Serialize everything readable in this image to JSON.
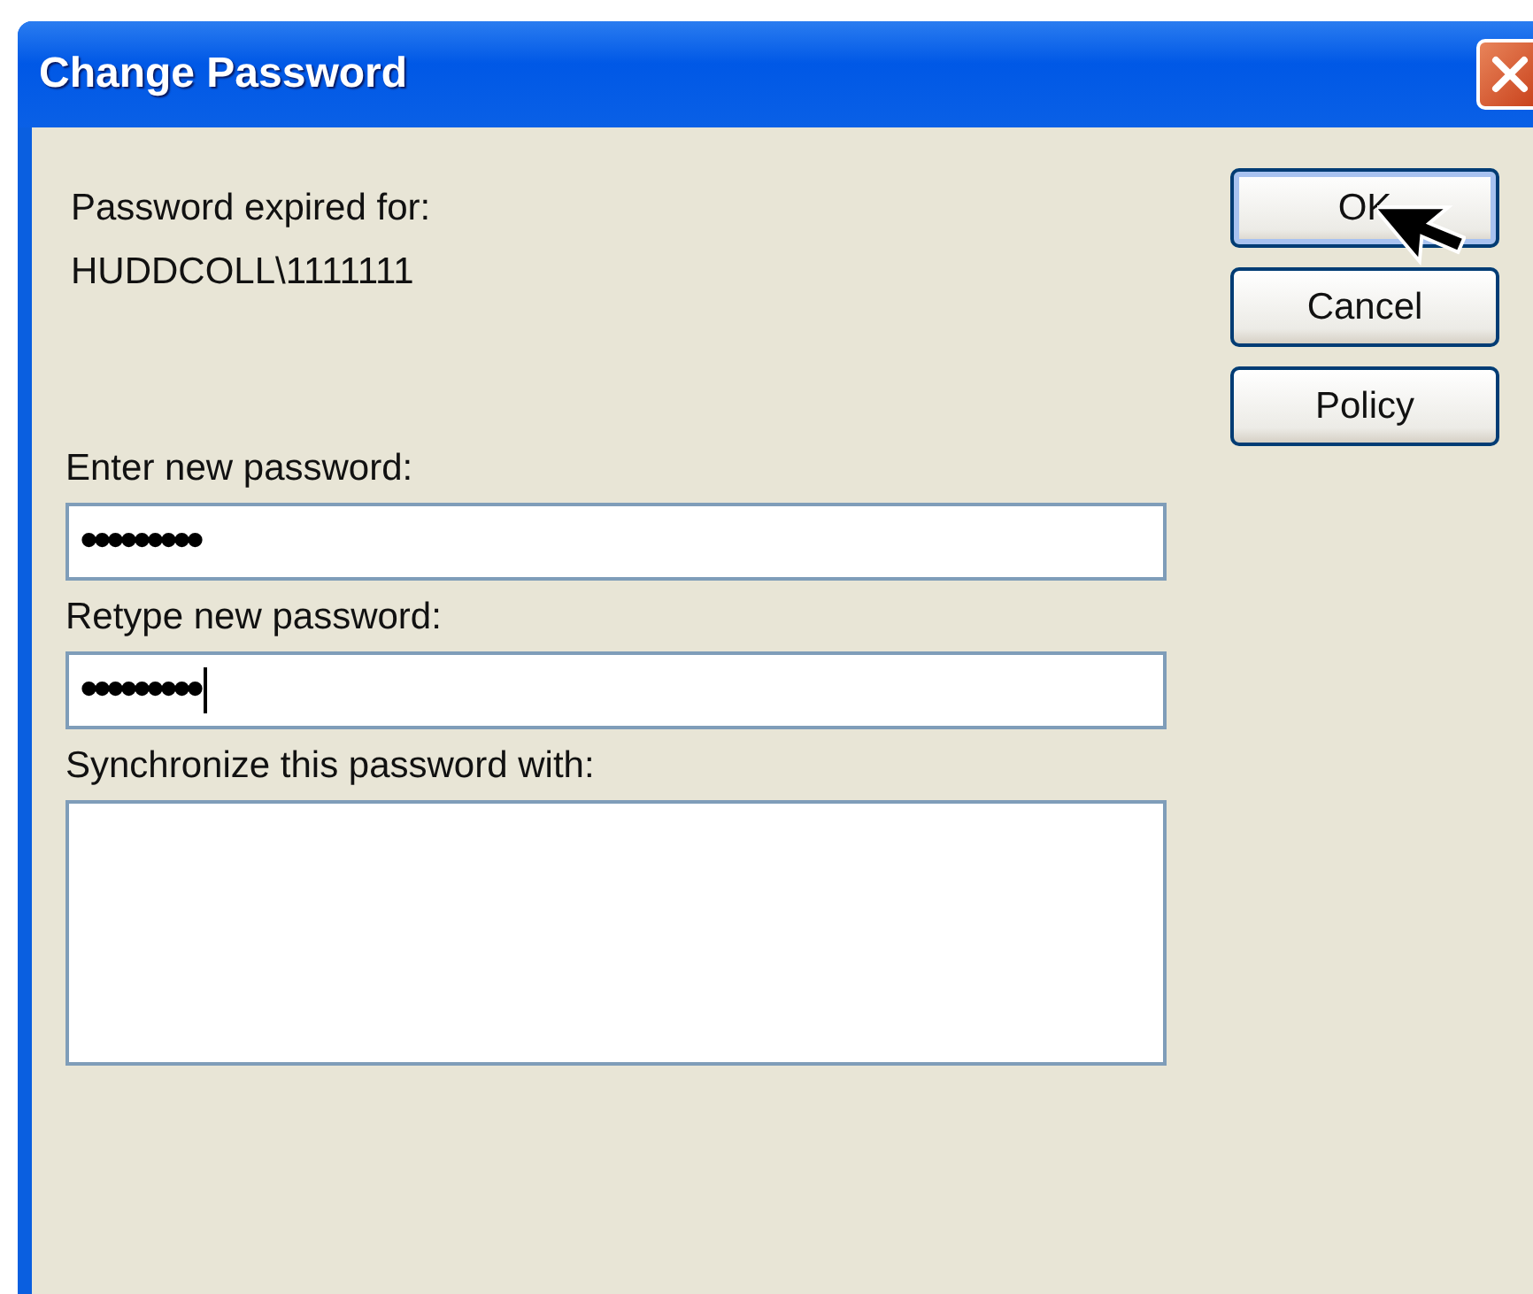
{
  "window": {
    "title": "Change Password"
  },
  "account": {
    "label": "Password expired for:",
    "value": "HUDDCOLL\\1111111"
  },
  "fields": [
    {
      "label": "Enter new password:",
      "value": "•••••••••",
      "caret": false
    },
    {
      "label": "Retype new password:",
      "value": "•••••••••",
      "caret": true
    }
  ],
  "sync": {
    "label": "Synchronize this password with:"
  },
  "buttons": [
    {
      "label": "OK",
      "focused": true
    },
    {
      "label": "Cancel",
      "focused": false
    },
    {
      "label": "Policy",
      "focused": false
    }
  ]
}
